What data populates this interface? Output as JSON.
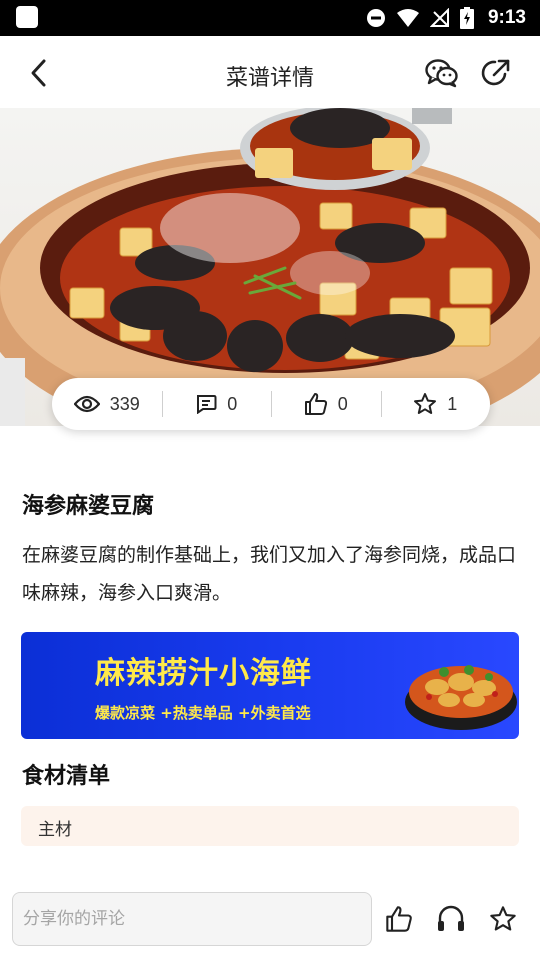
{
  "status_bar": {
    "time": "9:13"
  },
  "header": {
    "title": "菜谱详情",
    "back_icon": "chevron-left-icon",
    "wechat_icon": "wechat-icon",
    "share_icon": "share-icon"
  },
  "stats": [
    {
      "icon": "eye-icon",
      "count": "339"
    },
    {
      "icon": "comment-icon",
      "count": "0"
    },
    {
      "icon": "thumbs-up-icon",
      "count": "0"
    },
    {
      "icon": "star-icon",
      "count": "1"
    }
  ],
  "recipe": {
    "title": "海参麻婆豆腐",
    "description": "在麻婆豆腐的制作基础上，我们又加入了海参同烧，成品口味麻辣，海参入口爽滑。"
  },
  "banner": {
    "title": "麻辣捞汁小海鲜",
    "subtitle": "爆款凉菜 +热卖单品 +外卖首选"
  },
  "ingredients": {
    "title": "食材清单",
    "main_label": "主材"
  },
  "bottom_bar": {
    "comment_placeholder": "分享你的评论"
  },
  "colors": {
    "banner_blue": "#1a3cf0",
    "banner_text": "#ffe94a",
    "ingredient_bg": "#fdf3ec"
  }
}
